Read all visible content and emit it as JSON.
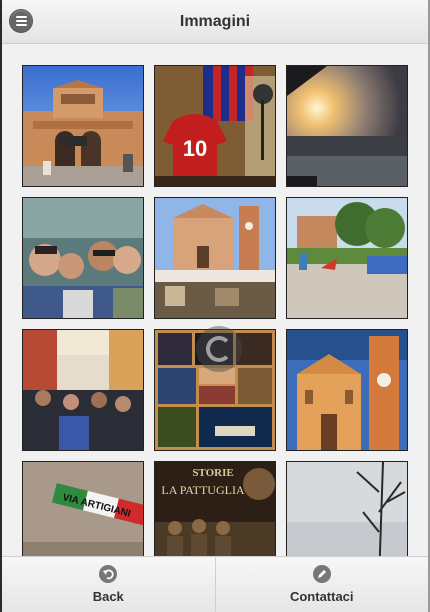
{
  "header": {
    "title": "Immagini"
  },
  "gallery": [
    {
      "icon": "photo-arcade-building"
    },
    {
      "icon": "photo-football-jersey-10"
    },
    {
      "icon": "photo-sunset-road"
    },
    {
      "icon": "photo-group-selfie"
    },
    {
      "icon": "photo-church-market"
    },
    {
      "icon": "photo-playground"
    },
    {
      "icon": "photo-crowded-street"
    },
    {
      "icon": "photo-collage-night"
    },
    {
      "icon": "photo-church-bell-tower"
    },
    {
      "icon": "photo-artigiani-sign"
    },
    {
      "icon": "photo-la-pattuglia-poster"
    },
    {
      "icon": "photo-bare-trees"
    }
  ],
  "photo_text": {
    "jersey_number": "10",
    "sign_text": "VIA ARTIGIANI",
    "poster_text": "LA PATTUGLIA",
    "poster_top": "STORIE"
  },
  "footer": {
    "back_label": "Back",
    "contact_label": "Contattaci"
  }
}
